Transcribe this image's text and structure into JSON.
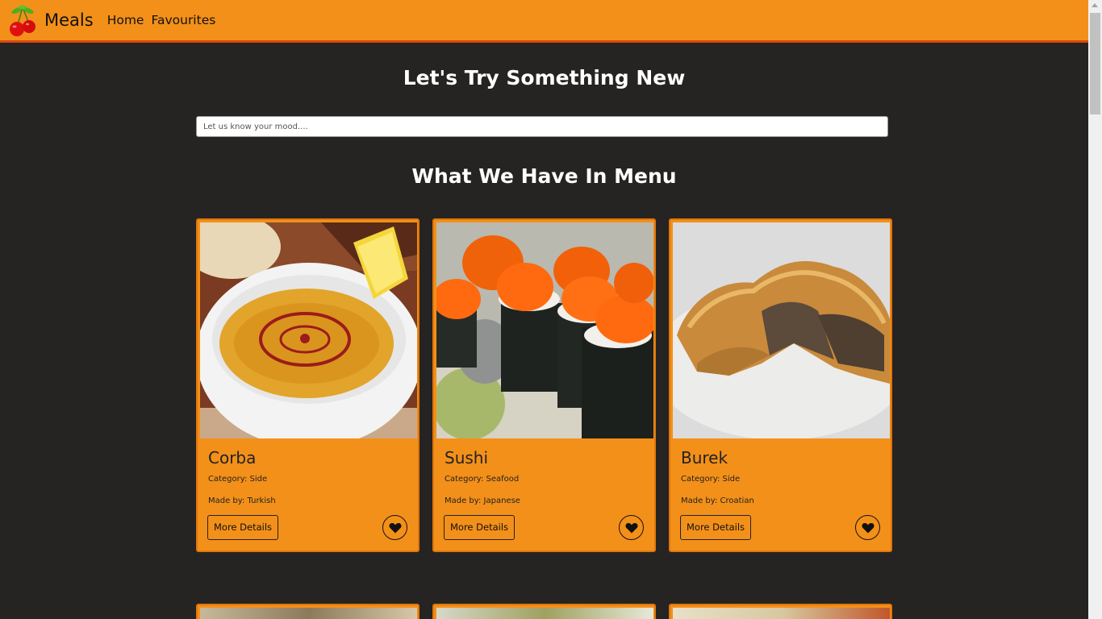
{
  "navbar": {
    "brand": "Meals",
    "links": [
      "Home",
      "Favourites"
    ],
    "logo_icon": "cherries-icon",
    "background": "#f39019"
  },
  "hero": {
    "title": "Let's Try Something New",
    "search_placeholder": "Let us know your mood...."
  },
  "menu": {
    "title": "What We Have In Menu",
    "cards": [
      {
        "name": "Corba",
        "category": "Category: Side",
        "origin": "Made by: Turkish",
        "button": "More Details",
        "favourite_icon": "heart-icon"
      },
      {
        "name": "Sushi",
        "category": "Category: Seafood",
        "origin": "Made by: Japanese",
        "button": "More Details",
        "favourite_icon": "heart-icon"
      },
      {
        "name": "Burek",
        "category": "Category: Side",
        "origin": "Made by: Croatian",
        "button": "More Details",
        "favourite_icon": "heart-icon"
      }
    ]
  },
  "colors": {
    "page_background": "#262323",
    "accent": "#f39019",
    "card_border": "#e0760a",
    "nav_border": "#d9480f"
  }
}
